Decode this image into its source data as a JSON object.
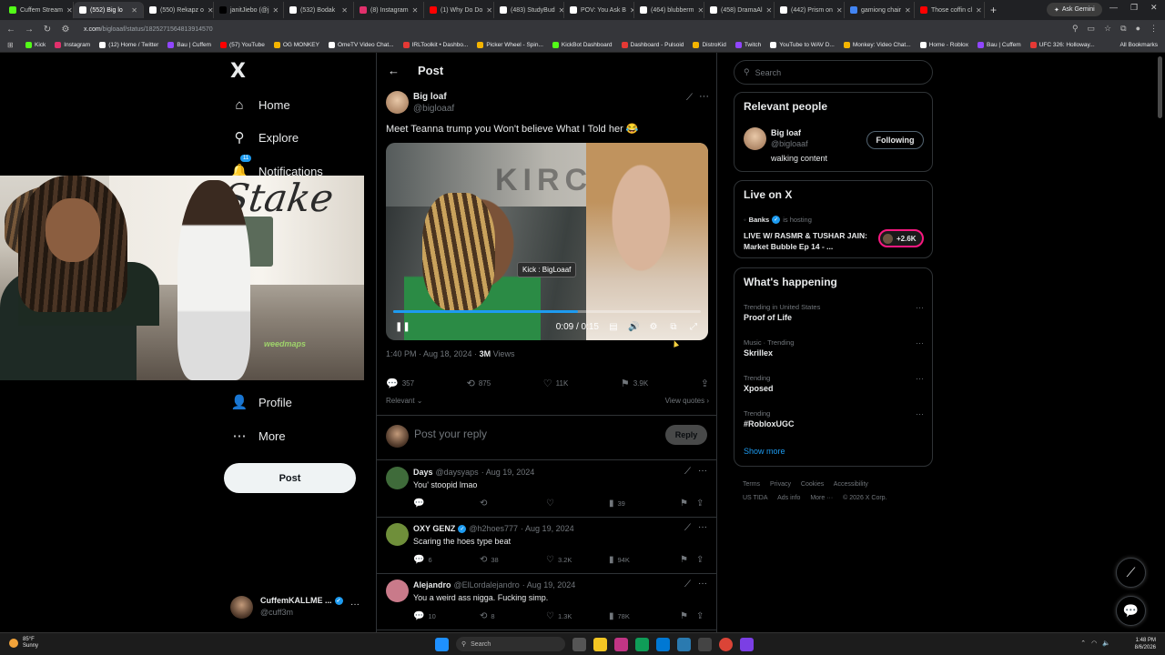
{
  "browser": {
    "tabs": [
      {
        "title": "Cuffem Stream",
        "color": "#53fc18"
      },
      {
        "title": "(552) Big lo",
        "color": "#ffffff",
        "active": true
      },
      {
        "title": "(550) Rekapz o",
        "color": "#ffffff"
      },
      {
        "title": "janitJiebo (@j",
        "color": "#000000"
      },
      {
        "title": "(532) Bodak",
        "color": "#ffffff"
      },
      {
        "title": "(8) Instagram",
        "color": "#e1306c"
      },
      {
        "title": "(1) Why Do Do",
        "color": "#ff0000"
      },
      {
        "title": "(483) StudyBud",
        "color": "#ffffff"
      },
      {
        "title": "POV: You Ask B",
        "color": "#ffffff"
      },
      {
        "title": "(464) blubberm",
        "color": "#ffffff"
      },
      {
        "title": "(458) DramaAl",
        "color": "#ffffff"
      },
      {
        "title": "(442) Prism on",
        "color": "#ffffff"
      },
      {
        "title": "gamiong chair",
        "color": "#4285f4"
      },
      {
        "title": "Those coffin cl",
        "color": "#ff0000"
      }
    ],
    "new_tab": "+",
    "ask_gemini": "Ask Gemini",
    "url_domain": "x.com",
    "url_path": "/bigloaaf/status/1825271564813914570",
    "bookmarks": [
      {
        "label": "Kick",
        "color": "#53fc18"
      },
      {
        "label": "Instagram",
        "color": "#e1306c"
      },
      {
        "label": "(12) Home / Twitter",
        "color": "#ffffff"
      },
      {
        "label": "Bau | Cuffem",
        "color": "#9146ff"
      },
      {
        "label": "(57) YouTube",
        "color": "#ff0000"
      },
      {
        "label": "OG MONKEY",
        "color": "#f4b400"
      },
      {
        "label": "OmeTV Video Chat...",
        "color": "#ffffff"
      },
      {
        "label": "IRLToolkit • Dashbo...",
        "color": "#e53935"
      },
      {
        "label": "Picker Wheel - Spin...",
        "color": "#f4b400"
      },
      {
        "label": "KickBot Dashboard",
        "color": "#53fc18"
      },
      {
        "label": "Dashboard - Pulsoid",
        "color": "#e53935"
      },
      {
        "label": "DistroKid",
        "color": "#f4b400"
      },
      {
        "label": "Twitch",
        "color": "#9146ff"
      },
      {
        "label": "YouTube to WAV D...",
        "color": "#ffffff"
      },
      {
        "label": "Monkey: Video Chat...",
        "color": "#f4b400"
      },
      {
        "label": "Home - Roblox",
        "color": "#ffffff"
      },
      {
        "label": "Bau | Cuffem",
        "color": "#9146ff"
      },
      {
        "label": "UFC 326: Holloway...",
        "color": "#e53935"
      }
    ],
    "all_bookmarks": "All Bookmarks"
  },
  "nav": {
    "logo": "X",
    "items": [
      {
        "label": "Home",
        "icon": "home-icon",
        "glyph": "⌂"
      },
      {
        "label": "Explore",
        "icon": "search-icon",
        "glyph": "⚲"
      },
      {
        "label": "Notifications",
        "icon": "bell-icon",
        "glyph": "🔔",
        "badge": "11"
      },
      {
        "label": "Profile",
        "icon": "person-icon",
        "glyph": "👤"
      },
      {
        "label": "More",
        "icon": "more-circle-icon",
        "glyph": "⋯"
      }
    ],
    "post_button": "Post",
    "account": {
      "name": "CuffemKALLME ...",
      "handle": "@cuff3m"
    }
  },
  "webcam": {
    "sign": "Stake",
    "shirt_logo": "weedmaps"
  },
  "post": {
    "header": "Post",
    "author": {
      "name": "Big loaf",
      "handle": "@bigloaaf"
    },
    "text": "Meet Teanna trump you Won't  believe What I Told her 😂",
    "video": {
      "watermark": "KIRC",
      "label": "Kick : BigLoaaf",
      "time": "0:09 / 0:15",
      "progress": 0.6
    },
    "timestamp": "1:40 PM · Aug 18, 2024 · ",
    "views_count": "3M",
    "views_label": " Views",
    "stats": {
      "replies": "357",
      "reposts": "875",
      "likes": "11K",
      "bookmarks": "3.9K"
    },
    "sort": "Relevant ⌄",
    "view_quotes": "View quotes ›",
    "reply_placeholder": "Post your reply",
    "reply_button": "Reply"
  },
  "replies": [
    {
      "name": "Days",
      "handle": "@daysyaps",
      "date": "· Aug 19, 2024",
      "text": "You' stoopid lmao",
      "verified": false,
      "replies": "",
      "reposts": "",
      "likes": "",
      "views": "39",
      "avatar_color": "#3f6b3a"
    },
    {
      "name": "OXY GENZ",
      "handle": "@h2hoes777",
      "date": "· Aug 19, 2024",
      "text": "Scaring the hoes type beat",
      "verified": true,
      "replies": "6",
      "reposts": "38",
      "likes": "3.2K",
      "views": "94K",
      "avatar_color": "#6f8f3a"
    },
    {
      "name": "Alejandro",
      "handle": "@ElLordalejandro",
      "date": "· Aug 19, 2024",
      "text": "You a weird ass nigga. Fucking simp.",
      "verified": false,
      "replies": "10",
      "reposts": "8",
      "likes": "1.3K",
      "views": "78K",
      "avatar_color": "#c97a8a"
    }
  ],
  "sidebar": {
    "search_placeholder": "Search",
    "relevant_people": {
      "title": "Relevant people",
      "name": "Big loaf",
      "handle": "@bigloaaf",
      "bio": "walking content",
      "follow_label": "Following"
    },
    "live": {
      "title": "Live on X",
      "host": "Banks",
      "host_suffix": "is hosting",
      "stream_title": "LIVE W/ RASMR & TUSHAR JAIN: Market Bubble Ep 14 - ...",
      "count": "+2.6K"
    },
    "happening": {
      "title": "What's happening",
      "trends": [
        {
          "meta": "Trending in United States",
          "name": "Proof of Life"
        },
        {
          "meta": "Music · Trending",
          "name": "Skrillex"
        },
        {
          "meta": "Trending",
          "name": "Xposed"
        },
        {
          "meta": "Trending",
          "name": "#RobloxUGC"
        }
      ],
      "show_more": "Show more"
    },
    "footer": [
      "Terms",
      "Privacy",
      "Cookies",
      "Accessibility",
      "US TIDA",
      "Ads info",
      "More ···",
      "© 2026 X Corp."
    ]
  },
  "taskbar": {
    "temp": "85°F",
    "condition": "Sunny",
    "search": "Search",
    "time": "1:48 PM",
    "date": "8/6/2026"
  }
}
